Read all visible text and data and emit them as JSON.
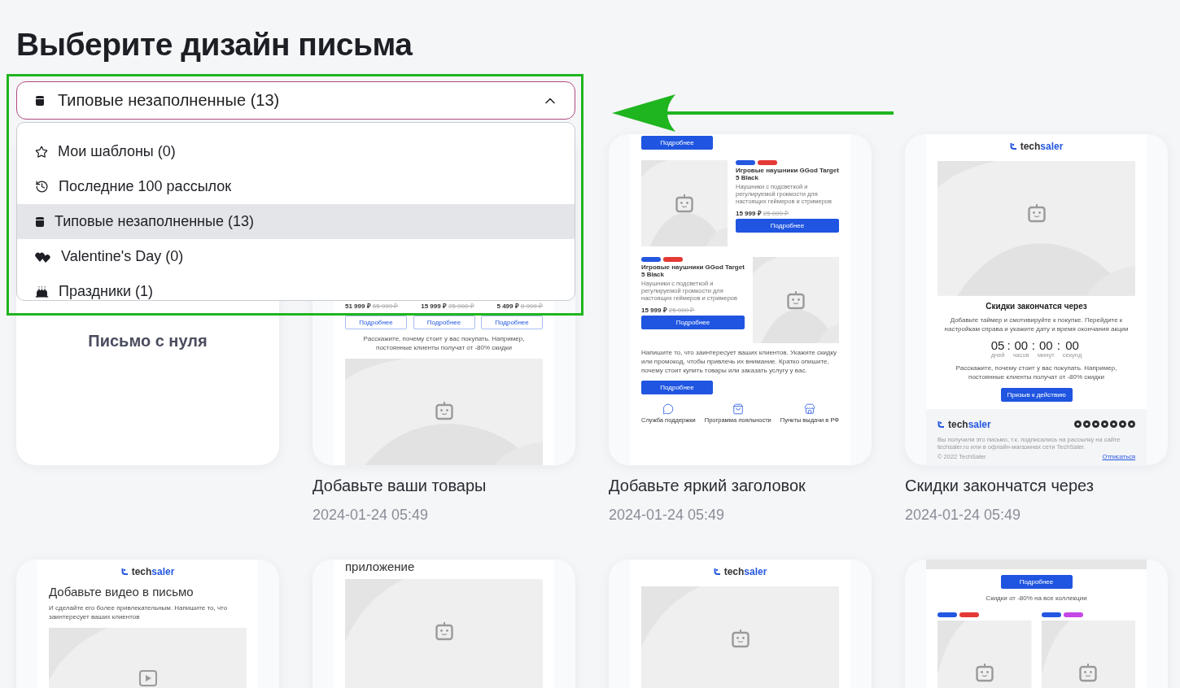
{
  "heading": "Выберите дизайн письма",
  "dropdown": {
    "value": "Типовые незаполненные (13)",
    "expanded": true
  },
  "menu": [
    {
      "kind": "favorites",
      "label": "Мои шаблоны (0)",
      "selected": false
    },
    {
      "kind": "recent",
      "label": "Последние 100 рассылок",
      "selected": false
    },
    {
      "kind": "standard",
      "label": "Типовые незаполненные (13)",
      "selected": true
    },
    {
      "kind": "valentine",
      "label": "Valentine's Day (0)",
      "selected": false
    },
    {
      "kind": "holiday",
      "label": "Праздники (1)",
      "selected": false
    }
  ],
  "annotation": {
    "color": "#1fb51f"
  },
  "cards": [
    {
      "kind": "blank",
      "title": "Письмо с нуля"
    },
    {
      "kind": "template",
      "title": "Добавьте ваши товары",
      "date": "2024-01-24 05:49",
      "preview": [
        {
          "kind": "prices",
          "items": [
            {
              "price": "51 999 ₽",
              "old": "65 999 ₽"
            },
            {
              "price": "15 999 ₽",
              "old": "25 000 ₽"
            },
            {
              "price": "5 499 ₽",
              "old": "8 999 ₽"
            }
          ]
        },
        {
          "kind": "buttons",
          "items": [
            "Подробнее",
            "Подробнее",
            "Подробнее"
          ]
        },
        {
          "kind": "caption",
          "text": "Расскажите, почему стоит у вас покупать. Например, постоянные клиенты получат от -80% скидки"
        },
        {
          "kind": "image"
        }
      ]
    },
    {
      "kind": "template",
      "title": "Добавьте яркий заголовок",
      "date": "2024-01-24 05:49",
      "preview": [
        {
          "kind": "button",
          "label": "Подробнее"
        },
        {
          "kind": "product",
          "tags": [
            {
              "color": "#2457e0"
            },
            {
              "color": "#e53935"
            }
          ],
          "name": "Игровые наушники GGod Target 5 Black",
          "desc": "Наушники с подсветкой и регулируемой громкости для настоящих геймеров и стримеров",
          "price": "15 999 ₽",
          "old": "25 000 ₽",
          "button": "Подробнее"
        },
        {
          "kind": "product-flipped",
          "tags": [
            {
              "color": "#2457e0"
            },
            {
              "color": "#e53935"
            }
          ],
          "name": "Игровые наушники GGod Target 5 Black",
          "desc": "Наушники с подсветкой и регулируемой громкости для настоящих геймеров и стримеров",
          "price": "15 999 ₽",
          "old": "25 000 ₽",
          "button": "Подробнее"
        },
        {
          "kind": "paragraph",
          "text": "Напишите то, что заинтересует ваших клиентов. Укажите скидку или промокод, чтобы привлечь их внимание. Кратко опишите, почему стоит купить товары или заказать услугу у вас."
        },
        {
          "kind": "button",
          "label": "Подробнее"
        },
        {
          "kind": "features",
          "items": [
            {
              "kind": "support",
              "label": "Служба поддержки"
            },
            {
              "kind": "loyalty",
              "label": "Программа лояльности"
            },
            {
              "kind": "pickup",
              "label": "Пункты выдачи в РФ"
            }
          ]
        }
      ]
    },
    {
      "kind": "template",
      "title": "Скидки закончатся через",
      "date": "2024-01-24 05:49",
      "preview": [
        {
          "kind": "logo",
          "text": "tech",
          "accent": "saler"
        },
        {
          "kind": "image"
        },
        {
          "kind": "title",
          "text": "Скидки закончатся через"
        },
        {
          "kind": "caption",
          "text": "Добавьте таймер и смотивируйте к покупке. Перейдите к настройкам справа и укажите дату и время окончания акции"
        },
        {
          "kind": "timer",
          "separator": ":",
          "units": [
            {
              "value": "05",
              "label": "дней"
            },
            {
              "value": "00",
              "label": "часов"
            },
            {
              "value": "00",
              "label": "минут"
            },
            {
              "value": "00",
              "label": "секунд"
            }
          ]
        },
        {
          "kind": "caption",
          "text": "Расскажите, почему стоит у вас покупать. Например, постоянные клиенты получат от -80% скидки"
        },
        {
          "kind": "cta",
          "label": "Призыв к действию"
        },
        {
          "kind": "footer",
          "logo": {
            "text": "tech",
            "accent": "saler"
          },
          "note": "Вы получили это письмо, т.к. подписались на рассылку на сайте techsaler.ru или в офлайн-магазинах сети TechSaler.",
          "copyright": "© 2022 TechSaler",
          "unsubscribe": "Отписаться"
        }
      ]
    },
    {
      "kind": "template",
      "preview": [
        {
          "kind": "logo",
          "text": "tech",
          "accent": "saler"
        },
        {
          "kind": "lead",
          "text": "Добавьте видео в письмо"
        },
        {
          "kind": "paragraph",
          "text": "И сделайте его более привлекательным. Напишите то, что заинтересует ваших клиентов"
        },
        {
          "kind": "video"
        }
      ]
    },
    {
      "kind": "template",
      "preview": [
        {
          "kind": "lead",
          "text": "приложение"
        },
        {
          "kind": "image"
        }
      ]
    },
    {
      "kind": "template",
      "preview": [
        {
          "kind": "logo",
          "text": "tech",
          "accent": "saler"
        },
        {
          "kind": "image"
        }
      ]
    },
    {
      "kind": "template",
      "preview": [
        {
          "kind": "band"
        },
        {
          "kind": "cta",
          "label": "Подробнее"
        },
        {
          "kind": "caption",
          "text": "Скидки от -80% на все коллекции"
        },
        {
          "kind": "tag-grid",
          "columns": [
            {
              "tags": [
                {
                  "color": "#2457e0"
                },
                {
                  "color": "#e53935"
                }
              ]
            },
            {
              "tags": [
                {
                  "color": "#2457e0"
                },
                {
                  "color": "#c447e6"
                }
              ]
            }
          ]
        }
      ]
    }
  ]
}
